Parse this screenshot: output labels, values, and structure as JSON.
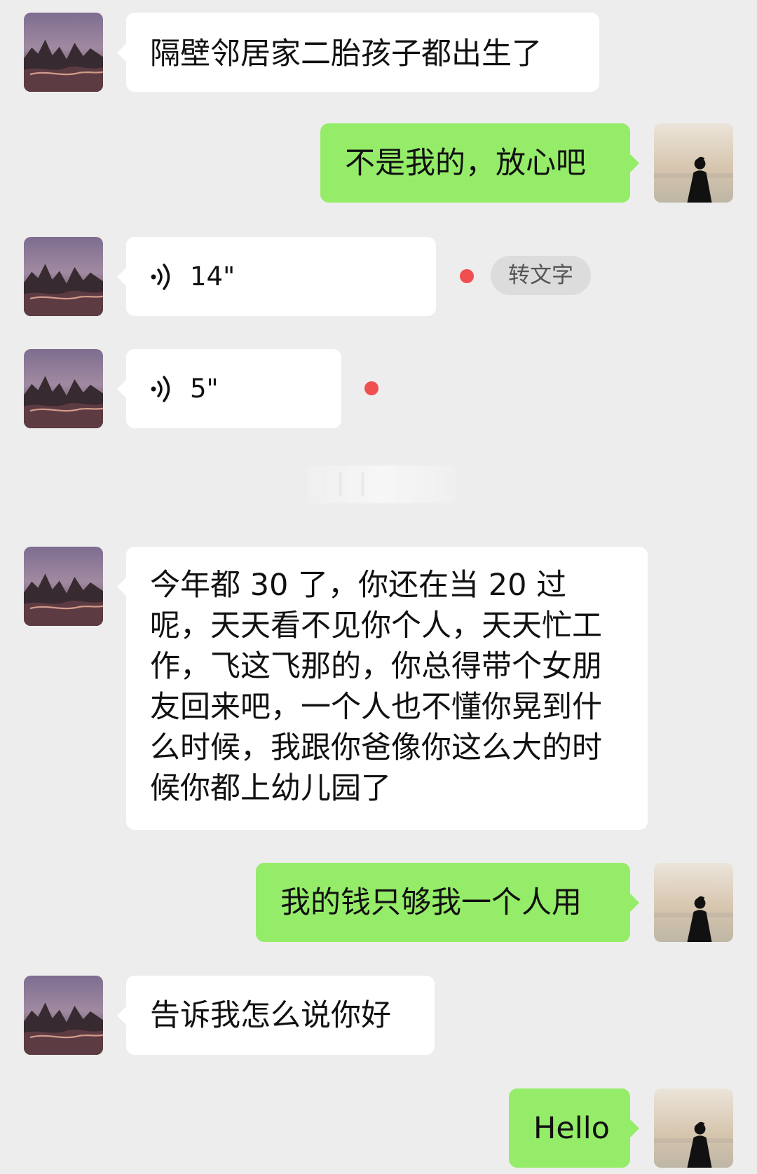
{
  "messages": [
    {
      "sender": "left",
      "kind": "text",
      "text": "隔壁邻居家二胎孩子都出生了"
    },
    {
      "sender": "right",
      "kind": "text",
      "text": "不是我的，放心吧"
    },
    {
      "sender": "left",
      "kind": "voice",
      "duration": "14\"",
      "unread": true,
      "action_label": "转文字"
    },
    {
      "sender": "left",
      "kind": "voice",
      "duration": "5\"",
      "unread": true
    },
    {
      "sender": "left",
      "kind": "text",
      "text": "今年都 30 了，你还在当 20 过呢，天天看不见你个人，天天忙工作，飞这飞那的，你总得带个女朋友回来吧，一个人也不懂你晃到什么时候，我跟你爸像你这么大的时候你都上幼儿园了"
    },
    {
      "sender": "right",
      "kind": "text",
      "text": "我的钱只够我一个人用"
    },
    {
      "sender": "left",
      "kind": "text",
      "text": "告诉我怎么说你好"
    },
    {
      "sender": "right",
      "kind": "text",
      "text": "Hello"
    }
  ],
  "colors": {
    "background": "#ededed",
    "left_bubble": "#ffffff",
    "right_bubble": "#95ec69",
    "unread_dot": "#f04f4f"
  },
  "icons": {
    "left_avatar": "mountain-landscape-avatar-icon",
    "right_avatar": "person-by-sea-avatar-icon",
    "voice": "voice-wave-icon"
  }
}
